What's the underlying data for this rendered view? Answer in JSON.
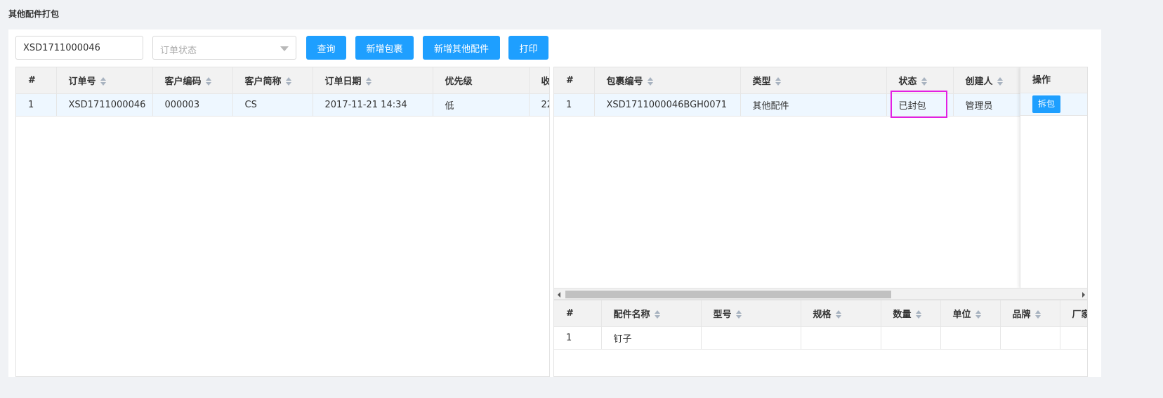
{
  "page": {
    "title": "其他配件打包"
  },
  "toolbar": {
    "order_input_value": "XSD1711000046",
    "status_placeholder": "订单状态",
    "query_label": "查询",
    "add_package_label": "新增包裹",
    "add_other_parts_label": "新增其他配件",
    "print_label": "打印"
  },
  "orders_table": {
    "headers": [
      "#",
      "订单号",
      "客户编码",
      "客户简称",
      "订单日期",
      "优先级",
      "收"
    ],
    "rows": [
      [
        "1",
        "XSD1711000046",
        "000003",
        "CS",
        "2017-11-21 14:34",
        "低",
        "22"
      ]
    ]
  },
  "packages_table": {
    "headers": [
      "#",
      "包裹编号",
      "类型",
      "状态",
      "创建人"
    ],
    "action_header": "操作",
    "rows": [
      [
        "1",
        "XSD1711000046BGH0071",
        "其他配件",
        "已封包",
        "管理员"
      ]
    ],
    "action_button": "拆包"
  },
  "parts_table": {
    "headers": [
      "#",
      "配件名称",
      "型号",
      "规格",
      "数量",
      "单位",
      "品牌",
      "厂家"
    ],
    "rows": [
      [
        "1",
        "钉子",
        "",
        "",
        "",
        "",
        "",
        ""
      ]
    ]
  },
  "colors": {
    "primary": "#1e9fff",
    "highlight": "#e31fe3",
    "selected_row": "#eef7ff"
  }
}
